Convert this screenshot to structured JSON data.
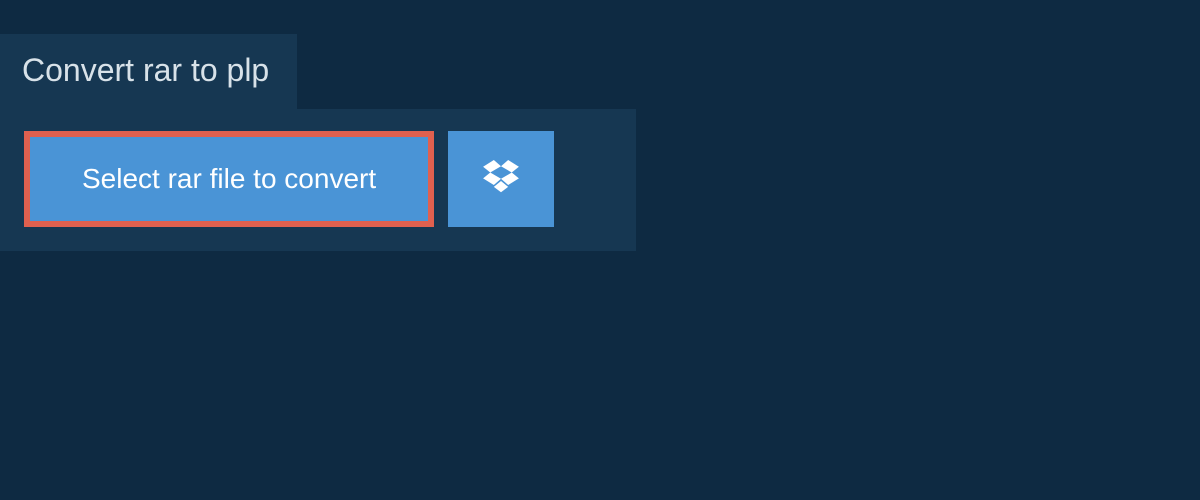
{
  "header": {
    "title": "Convert rar to plp"
  },
  "upload": {
    "select_label": "Select rar file to convert"
  }
}
